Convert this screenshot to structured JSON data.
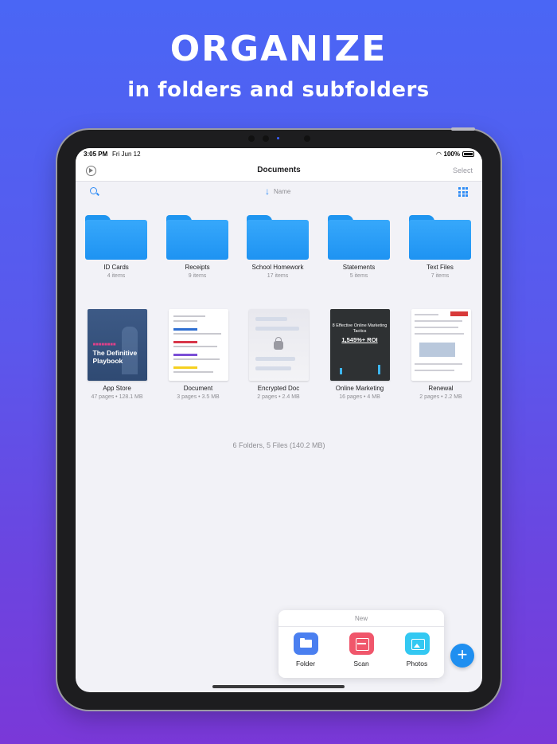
{
  "headline": "ORGANIZE",
  "subheadline": "in folders and subfolders",
  "status": {
    "time": "3:05 PM",
    "date": "Fri Jun 12",
    "battery": "100%"
  },
  "nav": {
    "title": "Documents",
    "select_label": "Select"
  },
  "toolbar": {
    "sort_label": "Name"
  },
  "folders": [
    {
      "name": "ID Cards",
      "meta": "4 items"
    },
    {
      "name": "Receipts",
      "meta": "9 items"
    },
    {
      "name": "School Homework",
      "meta": "17 items"
    },
    {
      "name": "Statements",
      "meta": "5 items"
    },
    {
      "name": "Text Files",
      "meta": "7 items"
    }
  ],
  "files": [
    {
      "name": "App Store",
      "meta": "47 pages • 128.1 MB",
      "thumb_text": "The Definitive Playbook"
    },
    {
      "name": "Document",
      "meta": "3 pages • 3.5 MB"
    },
    {
      "name": "Encrypted Doc",
      "meta": "2 pages • 2.4 MB"
    },
    {
      "name": "Online Marketing",
      "meta": "16 pages • 4 MB",
      "thumb_text": "8 Effective Online Marketing Tactics",
      "thumb_roi": "1,545%+ ROI"
    },
    {
      "name": "Renewal",
      "meta": "2 pages • 2.2 MB"
    }
  ],
  "summary": "6 Folders, 5 Files (140.2 MB)",
  "new_menu": {
    "title": "New",
    "actions": [
      {
        "label": "Folder",
        "icon": "folder-icon"
      },
      {
        "label": "Scan",
        "icon": "scan-icon"
      },
      {
        "label": "Photos",
        "icon": "photos-icon"
      }
    ]
  },
  "colors": {
    "accent": "#1f8ff0",
    "folder": "#2a9ef7",
    "background_top": "#4a66f5",
    "background_bottom": "#7a38d8"
  }
}
